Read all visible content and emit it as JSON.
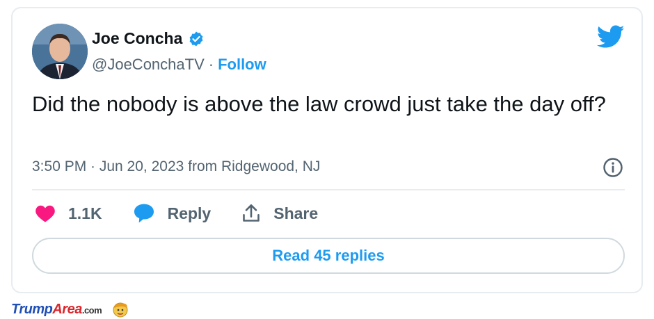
{
  "tweet": {
    "display_name": "Joe Concha",
    "handle": "@JoeConchaTV",
    "separator": "·",
    "follow_label": "Follow",
    "text": "Did the nobody is above the law crowd just take the day off?",
    "timestamp": "3:50 PM · Jun 20, 2023 from Ridgewood, NJ",
    "like_count": "1.1K",
    "reply_label": "Reply",
    "share_label": "Share",
    "read_replies_label": "Read 45 replies",
    "verified": true
  },
  "icons": {
    "verified": "verified-badge-icon",
    "brand": "twitter-bird-icon",
    "info": "info-icon",
    "like": "heart-icon",
    "reply": "speech-bubble-icon",
    "share": "share-icon"
  },
  "colors": {
    "accent": "#1d9bf0",
    "like": "#f91880",
    "text": "#0f1419",
    "secondary": "#536471"
  },
  "watermark": {
    "part1": "Trump",
    "part2": "Area",
    "suffix": ".com"
  }
}
